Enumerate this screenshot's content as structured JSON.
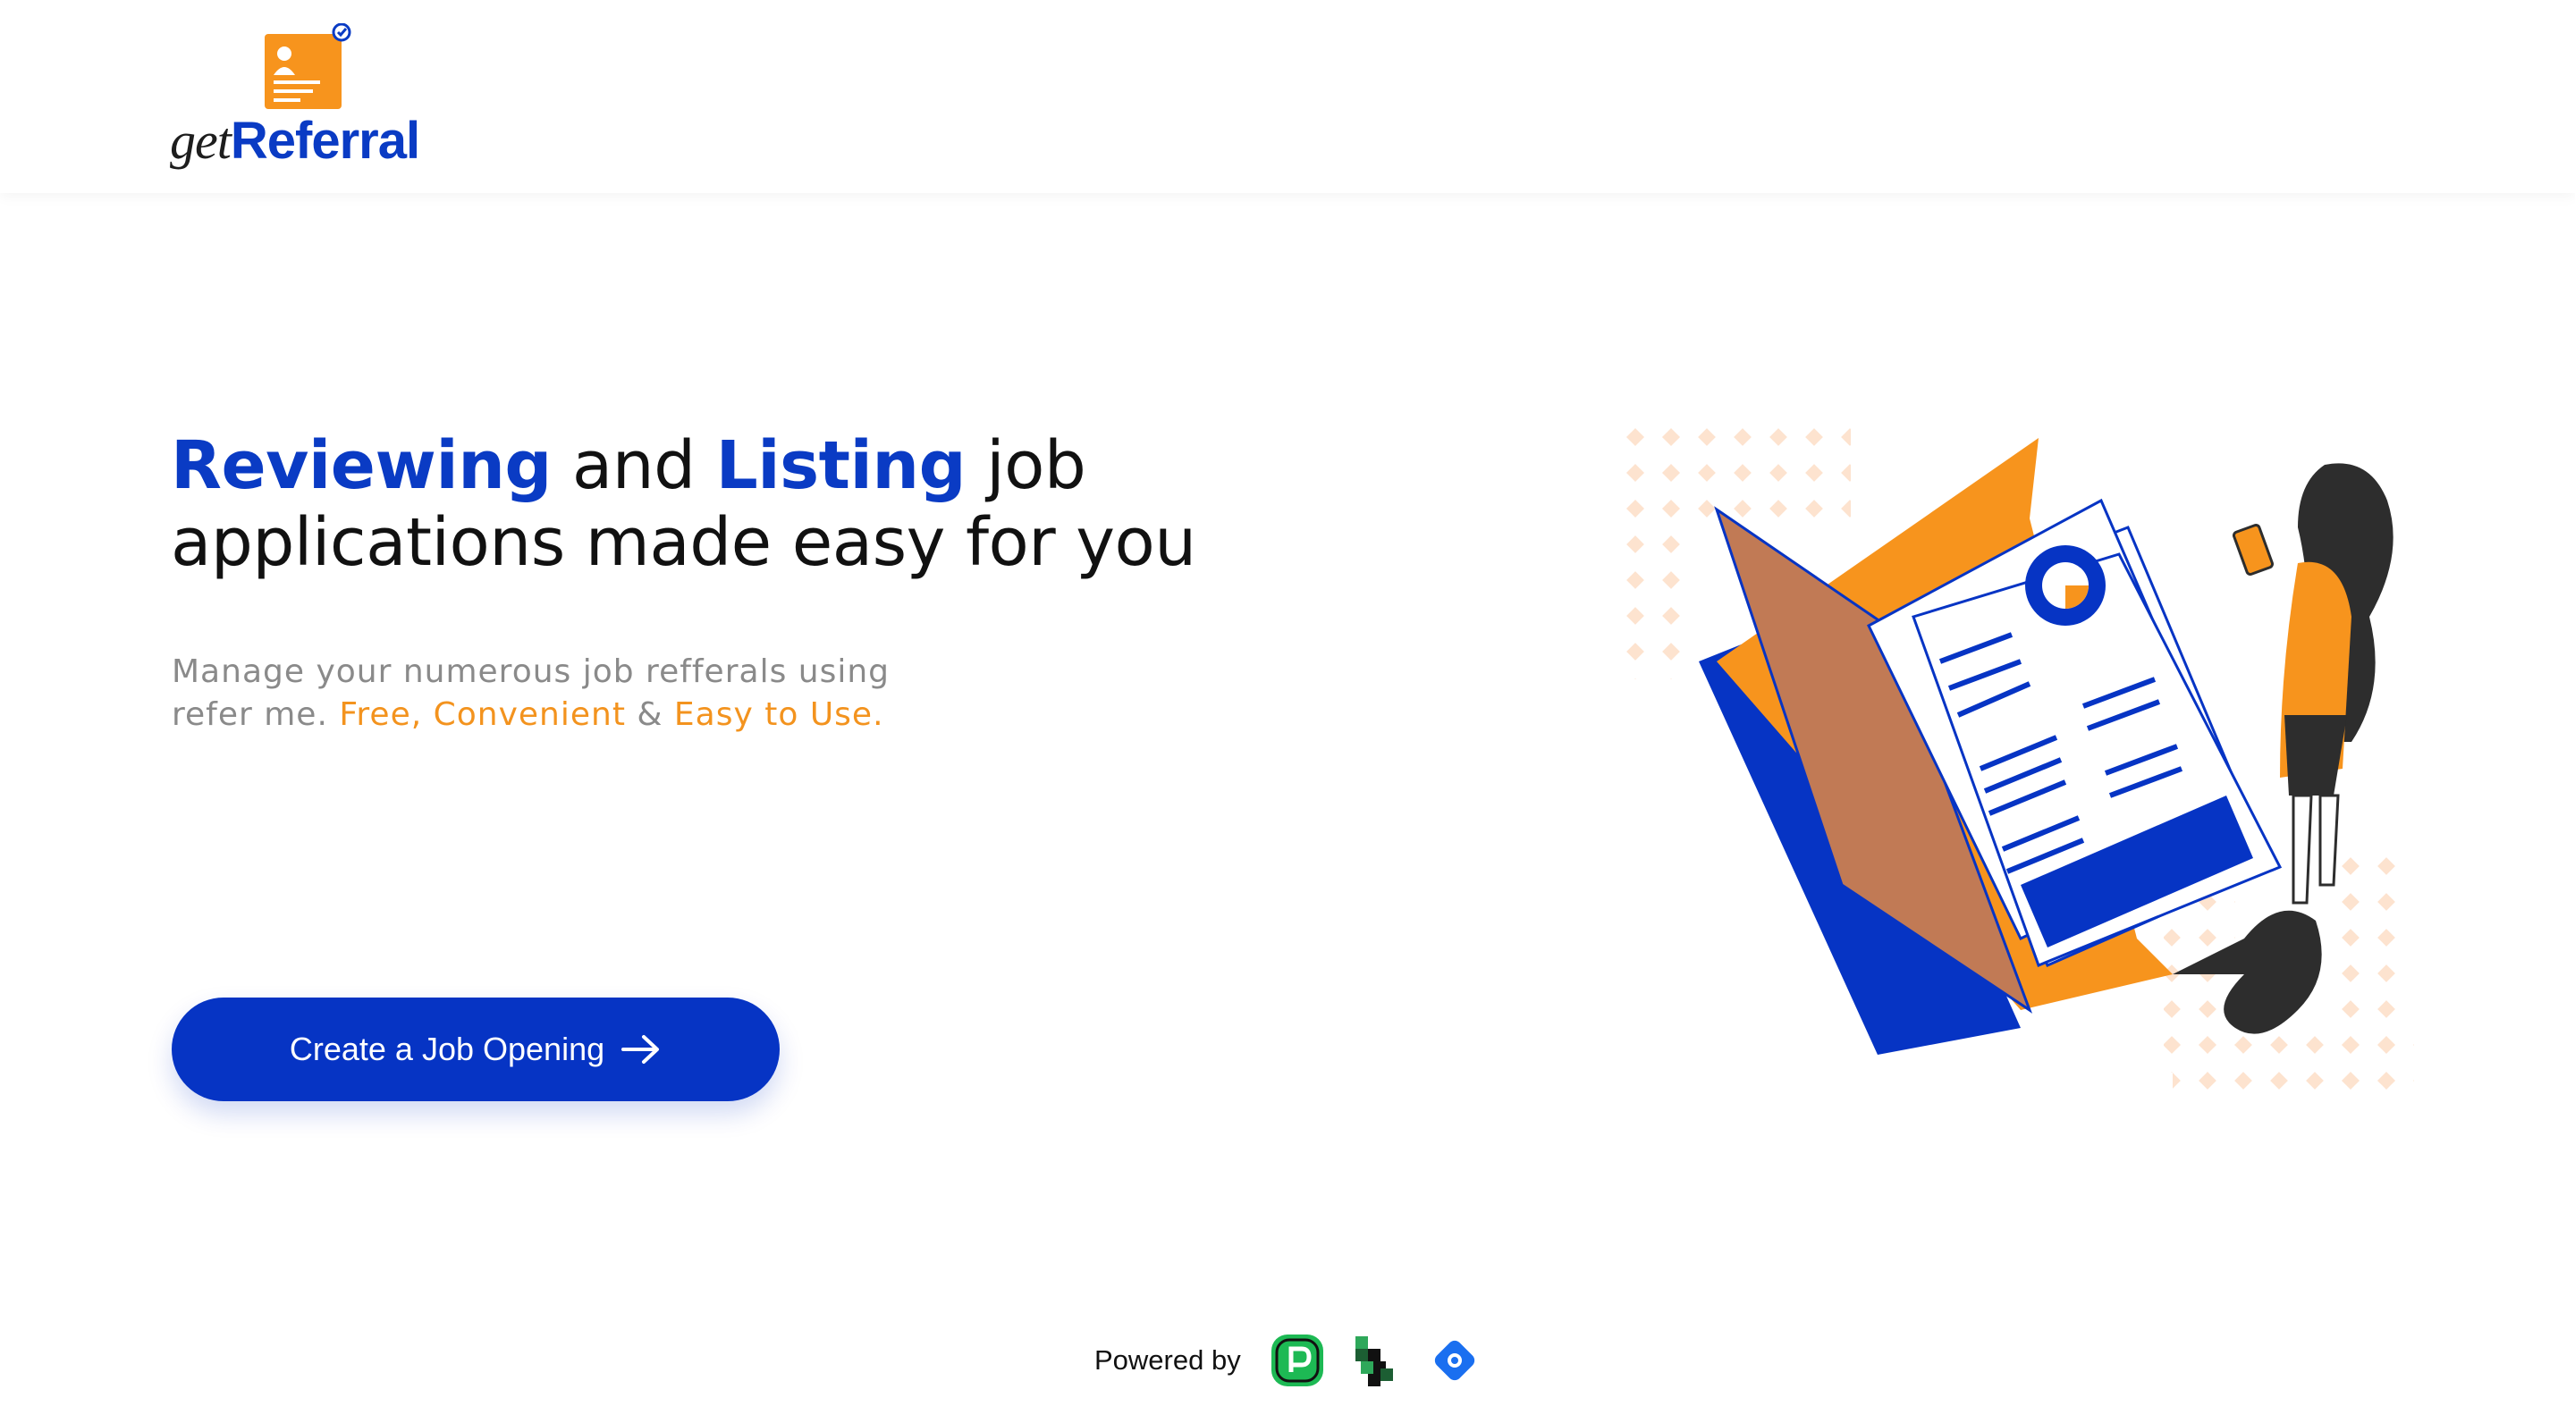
{
  "brand": {
    "name_part1": "get",
    "name_part2": "Referral",
    "primary_color": "#0a3bc4",
    "accent_color": "#f3931e"
  },
  "hero": {
    "title_w1": "Reviewing",
    "title_w2": " and ",
    "title_w3": "Listing",
    "title_w4": " job applications made easy for you",
    "sub_text": "Manage your numerous job refferals using refer me. ",
    "sub_hl1": "Free, Convenient",
    "sub_amp": " & ",
    "sub_hl2": "Easy to Use."
  },
  "cta": {
    "label": "Create a Job Opening",
    "icon": "arrow-right-icon"
  },
  "footer": {
    "powered_label": "Powered by",
    "sponsors": [
      "producthunt-icon",
      "layered-blocks-icon",
      "blue-diamond-icon"
    ]
  }
}
